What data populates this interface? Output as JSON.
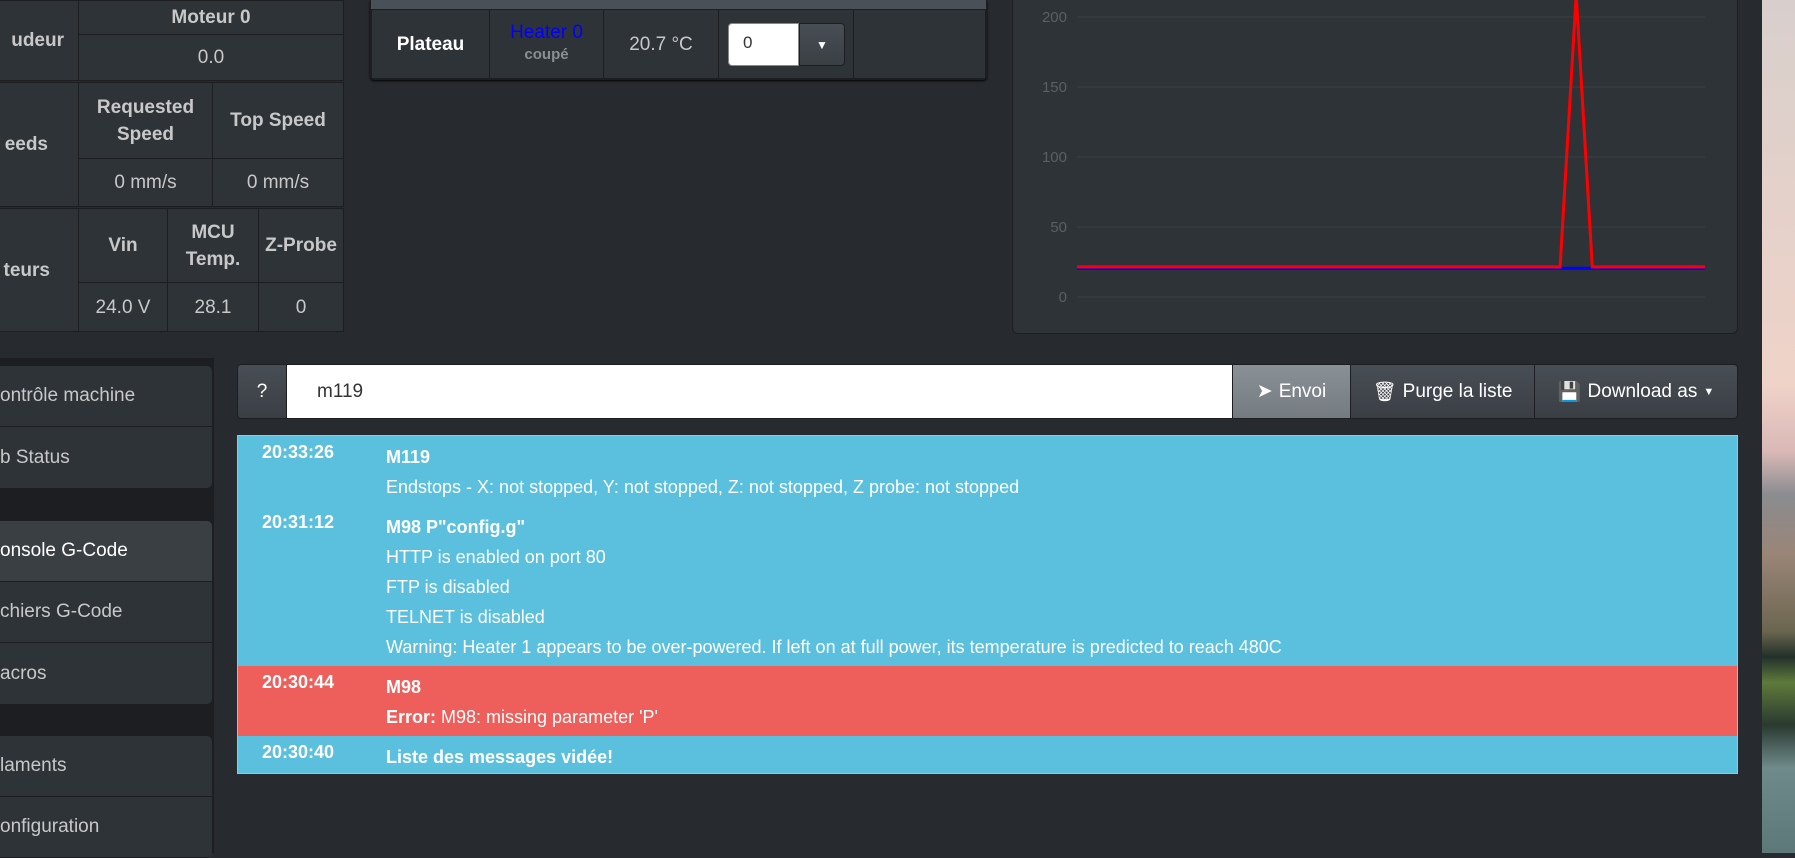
{
  "stats": {
    "extruder_label": "udeur",
    "motor_header": "Moteur 0",
    "motor_value": "0.0",
    "speeds_label": "eeds",
    "requested_speed_header": "Requested Speed",
    "top_speed_header": "Top Speed",
    "requested_speed_value": "0 mm/s",
    "top_speed_value": "0 mm/s",
    "sensors_label": "teurs",
    "vin_header": "Vin",
    "mcu_header": "MCU Temp.",
    "zprobe_header": "Z-Probe",
    "vin_value": "24.0 V",
    "mcu_value": "28.1",
    "zprobe_value": "0"
  },
  "heater": {
    "name": "Plateau",
    "heater_link": "Heater 0",
    "state": "coupé",
    "current_temp": "20.7 °C",
    "active_value": "0",
    "link_color": "#0000ff"
  },
  "chart_data": {
    "type": "line",
    "ylim": [
      0,
      225
    ],
    "yticks": [
      "0",
      "50",
      "100",
      "150",
      "200"
    ],
    "grid": true,
    "series": [
      {
        "color": "#0000ff",
        "values": [
          20.5,
          20.5,
          20.5,
          20.5,
          20.5,
          20.5,
          20.5,
          20.5,
          20.5,
          20.5,
          20.5,
          20.5,
          20.5,
          20.5,
          20.5,
          20.5,
          20.5,
          20.5,
          20.5,
          20.5,
          20.5,
          20.5,
          20.5,
          20.5,
          20.5,
          20.5,
          20.5,
          20.5,
          20.5,
          20.5,
          20.5,
          20.5,
          20.5,
          20.5,
          20.5,
          20.5,
          20.5,
          20.5,
          20.5,
          20.5
        ]
      },
      {
        "color": "#ff0000",
        "values": [
          21.5,
          21.5,
          21.5,
          21.5,
          21.5,
          21.5,
          21.5,
          21.5,
          21.5,
          21.5,
          21.5,
          21.5,
          21.5,
          21.5,
          21.5,
          21.5,
          21.5,
          21.5,
          21.5,
          21.5,
          21.5,
          21.5,
          21.5,
          21.5,
          21.5,
          21.5,
          21.5,
          21.5,
          21.5,
          21.5,
          21.5,
          500,
          21.5,
          21.5,
          21.5,
          21.5,
          21.5,
          21.5,
          21.5,
          21.5
        ]
      }
    ]
  },
  "sidebar": {
    "items": [
      {
        "label": "ontrôle machine"
      },
      {
        "label": "b Status"
      },
      {
        "label": "onsole G-Code"
      },
      {
        "label": "chiers G-Code"
      },
      {
        "label": "acros"
      },
      {
        "label": "laments"
      },
      {
        "label": "onfiguration"
      }
    ]
  },
  "command": {
    "help_label": "?",
    "input_value": "m119",
    "send_label": "Envoi",
    "purge_label": "Purge la liste",
    "download_label": "Download as"
  },
  "log": [
    {
      "time": "20:33:26",
      "type": "info",
      "lines": [
        "M119",
        "Endstops - X: not stopped, Y: not stopped, Z: not stopped, Z probe: not stopped"
      ]
    },
    {
      "time": "20:31:12",
      "type": "info",
      "lines": [
        "M98 P\"config.g\"",
        "HTTP is enabled on port 80",
        "FTP is disabled",
        "TELNET is disabled",
        "Warning: Heater 1 appears to be over-powered. If left on at full power, its temperature is predicted to reach 480C"
      ]
    },
    {
      "time": "20:30:44",
      "type": "error",
      "lines": [
        "M98"
      ],
      "error_prefix": "Error:",
      "error_text": " M98: missing parameter 'P'"
    },
    {
      "time": "20:30:40",
      "type": "info",
      "lines": [
        "Liste des messages vidée!"
      ]
    }
  ],
  "colors": {
    "info": "#5bc0de",
    "error": "#ee5f5b",
    "background": "#272b30",
    "panel": "#2e3338"
  }
}
